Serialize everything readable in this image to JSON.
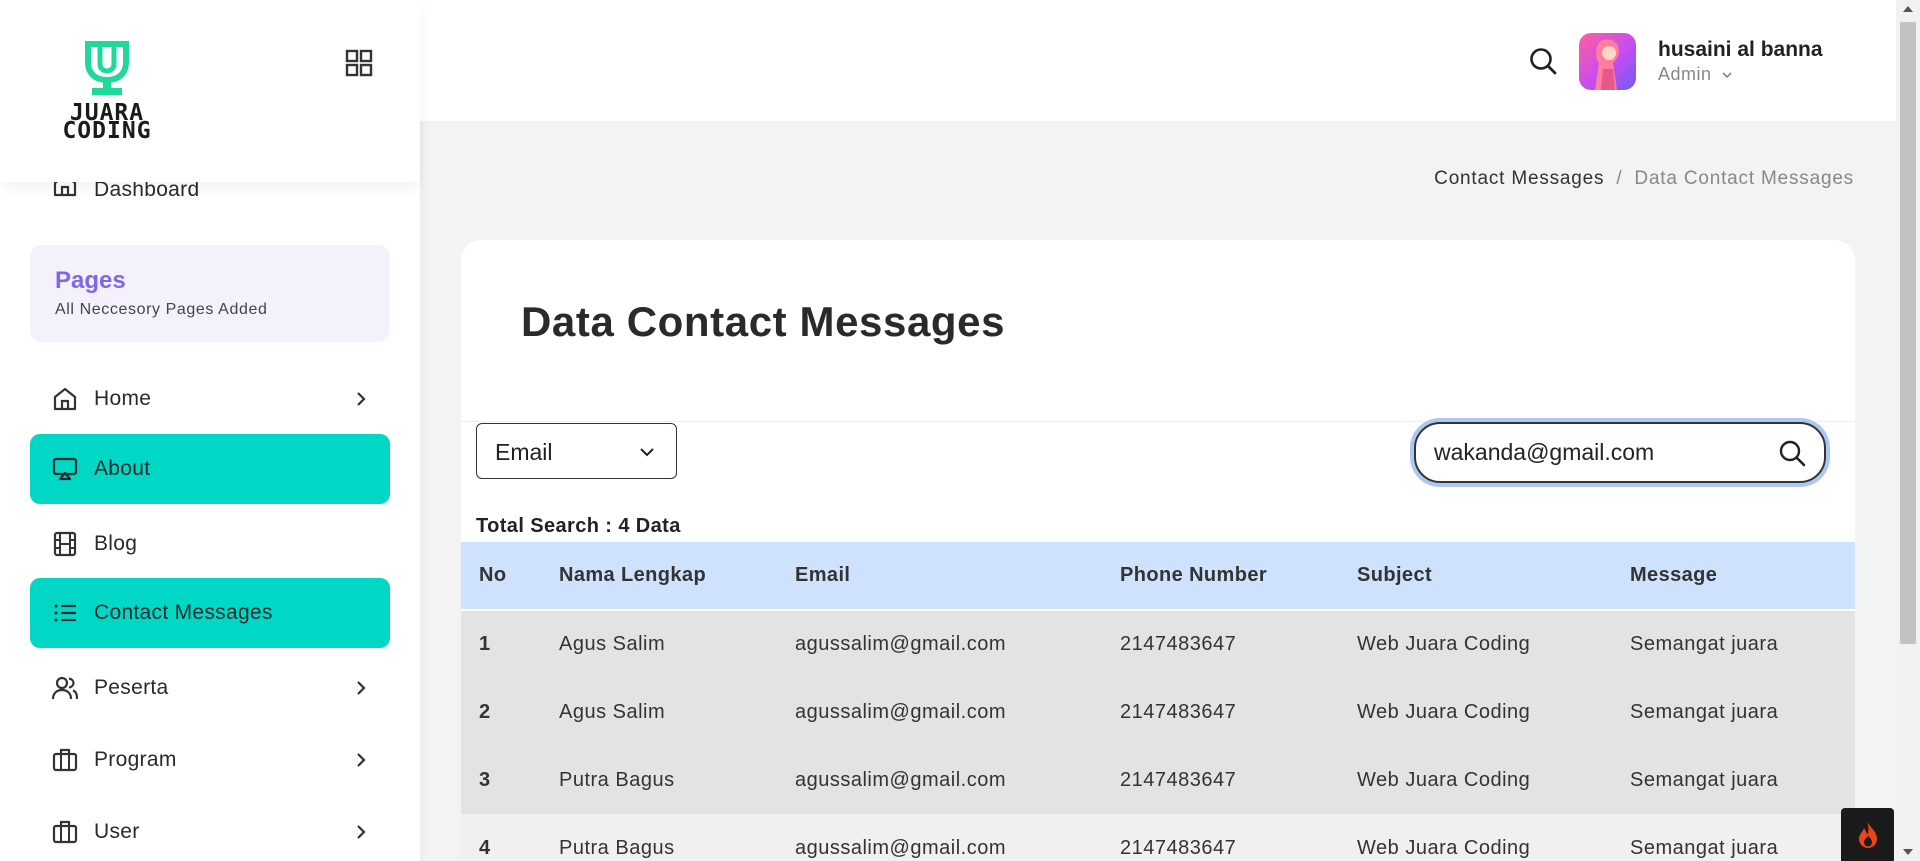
{
  "brand": {
    "logo_line1": "JUARA",
    "logo_line2": "CODING"
  },
  "sidebar": {
    "dashboard": "Dashboard",
    "pages_card": {
      "title": "Pages",
      "subtitle": "All Neccesory Pages Added"
    },
    "items": [
      {
        "label": "Home",
        "icon": "home-icon",
        "has_chevron": true,
        "active": false
      },
      {
        "label": "About",
        "icon": "presentation-icon",
        "has_chevron": false,
        "active": true
      },
      {
        "label": "Blog",
        "icon": "film-icon",
        "has_chevron": false,
        "active": false
      },
      {
        "label": "Contact Messages",
        "icon": "list-icon",
        "has_chevron": false,
        "active": true
      },
      {
        "label": "Peserta",
        "icon": "users-icon",
        "has_chevron": true,
        "active": false
      },
      {
        "label": "Program",
        "icon": "briefcase-icon",
        "has_chevron": true,
        "active": false
      },
      {
        "label": "User",
        "icon": "briefcase-icon",
        "has_chevron": true,
        "active": false
      }
    ]
  },
  "header": {
    "user_name": "husaini al banna",
    "user_role": "Admin"
  },
  "breadcrumb": {
    "parent": "Contact Messages",
    "separator": "/",
    "current": "Data Contact Messages"
  },
  "main": {
    "title": "Data Contact Messages",
    "filter_select": {
      "value": "Email"
    },
    "search": {
      "value": "wakanda@gmail.com"
    },
    "total_text": "Total Search : 4 Data",
    "table": {
      "columns": [
        "No",
        "Nama Lengkap",
        "Email",
        "Phone Number",
        "Subject",
        "Message"
      ],
      "rows": [
        [
          "1",
          "Agus Salim",
          "agussalim@gmail.com",
          "2147483647",
          "Web Juara Coding",
          "Semangat juara"
        ],
        [
          "2",
          "Agus Salim",
          "agussalim@gmail.com",
          "2147483647",
          "Web Juara Coding",
          "Semangat juara"
        ],
        [
          "3",
          "Putra Bagus",
          "agussalim@gmail.com",
          "2147483647",
          "Web Juara Coding",
          "Semangat juara"
        ],
        [
          "4",
          "Putra Bagus",
          "agussalim@gmail.com",
          "2147483647",
          "Web Juara Coding",
          "Semangat juara"
        ]
      ]
    }
  },
  "colors": {
    "accent": "#00d8c5",
    "pages_title": "#7c68e8",
    "table_header": "#cfe2fd",
    "logo_green": "#1ed99a"
  }
}
